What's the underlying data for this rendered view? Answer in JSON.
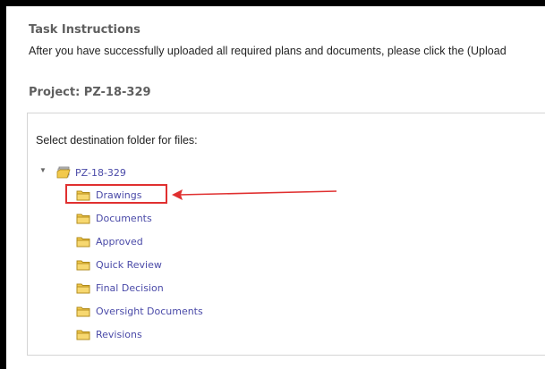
{
  "task": {
    "heading": "Task Instructions",
    "instructions": "After you have successfully uploaded all required plans and documents, please click the (Upload"
  },
  "project": {
    "title": "Project: PZ-18-329"
  },
  "folder_picker": {
    "prompt": "Select destination folder for files:",
    "root": {
      "label": "PZ-18-329",
      "expanded": true,
      "icon": "folder-stack-icon"
    },
    "children": [
      {
        "label": "Drawings",
        "highlighted": true
      },
      {
        "label": "Documents"
      },
      {
        "label": "Approved"
      },
      {
        "label": "Quick Review"
      },
      {
        "label": "Final Decision"
      },
      {
        "label": "Oversight Documents"
      },
      {
        "label": "Revisions"
      }
    ]
  },
  "colors": {
    "link": "#4a4aa8",
    "annotation": "#e03030",
    "folder": "#f2c94c"
  }
}
